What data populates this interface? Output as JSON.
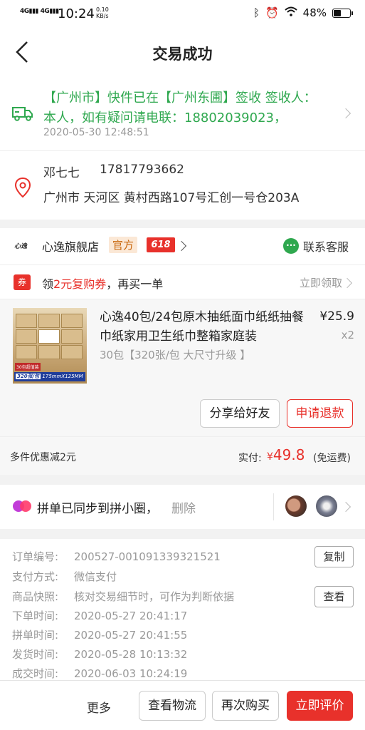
{
  "status_bar": {
    "signal1": "4G",
    "signal2": "4G",
    "time": "10:24",
    "net_speed_value": "0.10",
    "net_speed_unit": "KB/s",
    "battery": "48%",
    "battery_level": 0.48
  },
  "nav": {
    "title": "交易成功",
    "back_icon": "chevron-left-icon"
  },
  "logistics": {
    "text": "【广州市】快件已在【广州东圃】签收 签收人：本人，如有疑问请电联：18802039023，",
    "time": "2020-05-30 12:48:51",
    "icon": "truck-icon"
  },
  "address": {
    "name": "邓七七",
    "phone": "17817793662",
    "address": "广州市 天河区 黄村西路107号汇创一号仓203A",
    "icon": "location-pin-icon"
  },
  "shop": {
    "logo": "心逸",
    "name": "心逸旗舰店",
    "badge_official": "官方",
    "badge_promo": "618",
    "service_label": "联系客服"
  },
  "coupon": {
    "tag": "券",
    "text_prefix": "领",
    "text_highlight": "2元复购券",
    "text_suffix": "，再买一单",
    "claim": "立即领取"
  },
  "product": {
    "title": "心逸40包/24包原木抽纸面巾纸纸抽餐巾纸家用卫生纸巾整箱家庭装",
    "price": "¥25.9",
    "quantity": "x2",
    "spec": "30包【320张/包 大尺寸升级 】",
    "thumb_caption_top": "30包超值装",
    "thumb_caption_sheets": "320张/包",
    "thumb_caption_size": "175mmX125MM",
    "share_label": "分享给好友",
    "refund_label": "申请退款"
  },
  "summary": {
    "discount": "多件优惠减2元",
    "paid_label": "实付:",
    "currency": "¥",
    "amount": "49.8",
    "shipping": "(免运费)"
  },
  "group": {
    "text": "拼单已同步到拼小圈，",
    "delete": "删除"
  },
  "order_info": {
    "rows": [
      {
        "key": "订单编号:",
        "value": "200527-001091339321521"
      },
      {
        "key": "支付方式:",
        "value": "微信支付"
      },
      {
        "key": "商品快照:",
        "value": "核对交易细节时，可作为判断依据"
      },
      {
        "key": "下单时间:",
        "value": "2020-05-27 20:41:17"
      },
      {
        "key": "拼单时间:",
        "value": "2020-05-27 20:41:55"
      },
      {
        "key": "发货时间:",
        "value": "2020-05-28 10:13:32"
      },
      {
        "key": "成交时间:",
        "value": "2020-06-03 10:24:19"
      }
    ],
    "copy_label": "复制",
    "view_label": "查看"
  },
  "bottom_bar": {
    "more": "更多",
    "logistics": "查看物流",
    "rebuy": "再次购买",
    "review": "立即评价"
  },
  "colors": {
    "accent_red": "#e8312b",
    "logistics_green": "#2fa84f"
  }
}
